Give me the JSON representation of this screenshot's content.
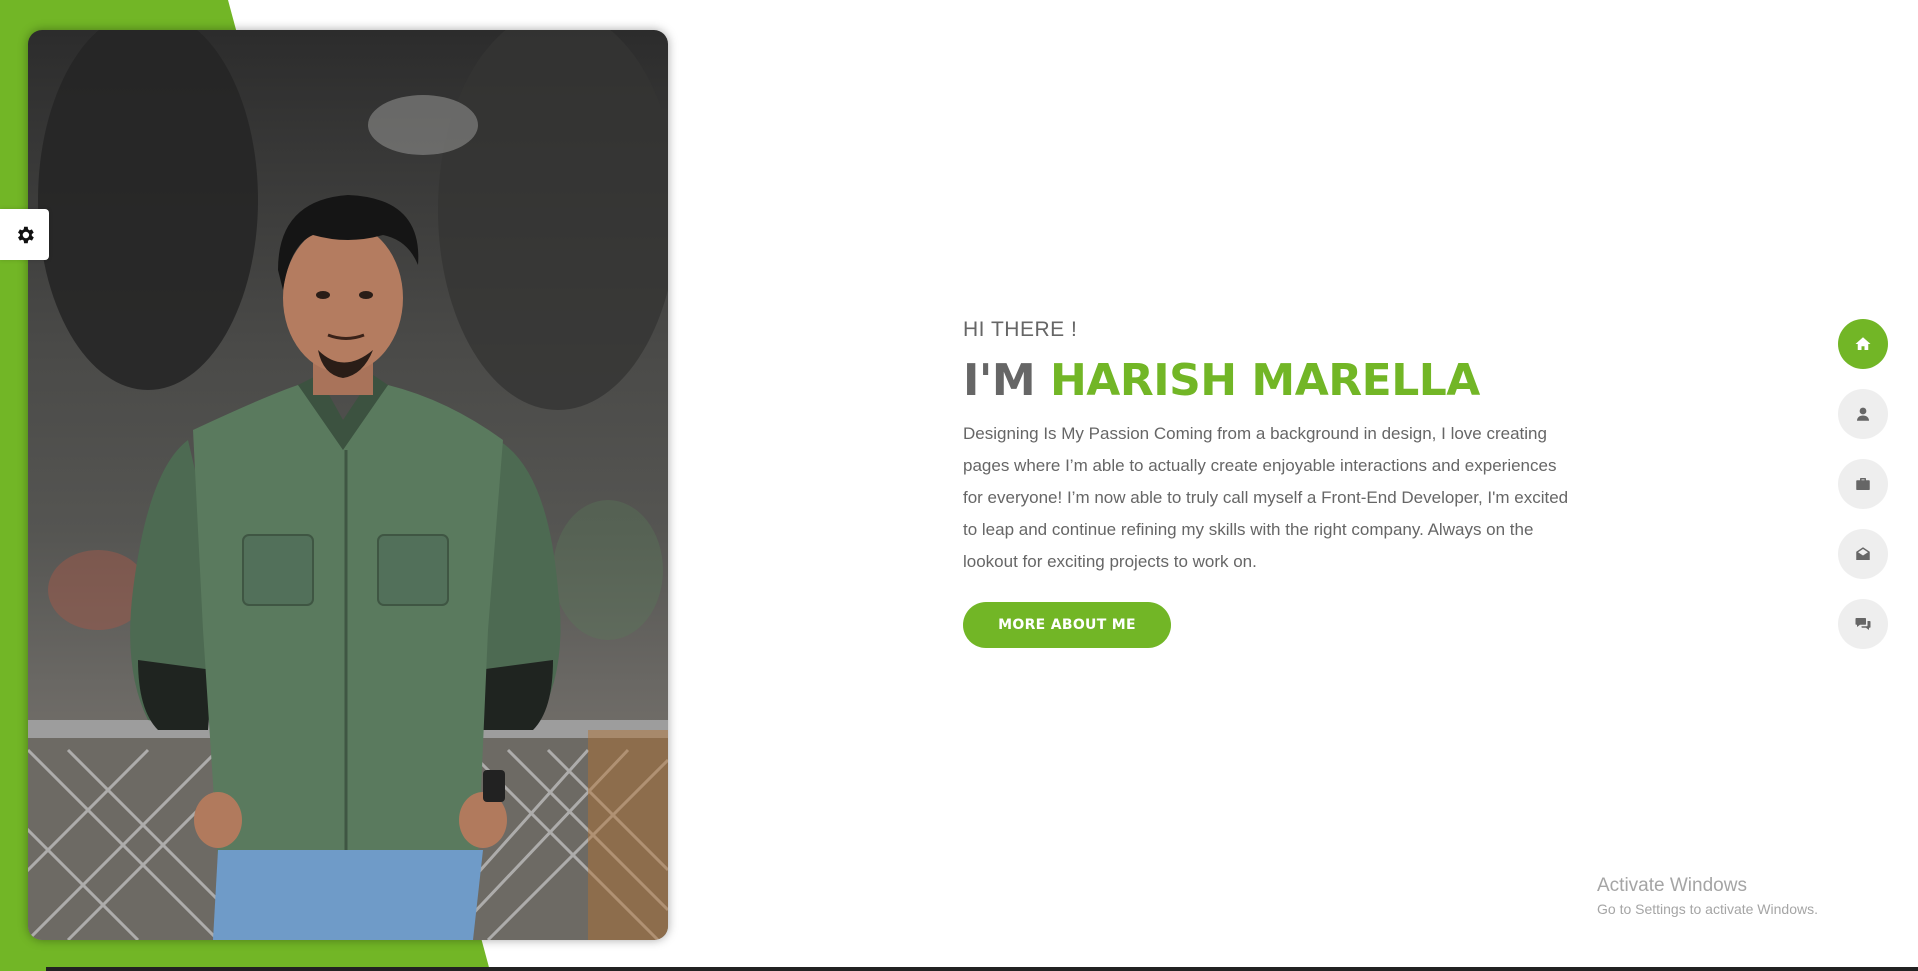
{
  "hero": {
    "greeting": "HI THERE !",
    "headline_prefix": "I'M",
    "name": "HARISH MARELLA",
    "description": "Designing Is My Passion Coming from a background in design, I love creating pages where I’m able to actually create enjoyable interactions and experiences for everyone! I’m now able to truly call myself a Front-End Developer, I'm excited to leap and continue refining my skills with the right company. Always on the lookout for exciting projects to work on.",
    "cta_label": "MORE ABOUT ME"
  },
  "settings": {
    "icon": "gear-icon"
  },
  "nav": {
    "items": [
      {
        "icon": "home-icon",
        "active": true
      },
      {
        "icon": "user-icon",
        "active": false
      },
      {
        "icon": "briefcase-icon",
        "active": false
      },
      {
        "icon": "envelope-open-icon",
        "active": false
      },
      {
        "icon": "comments-icon",
        "active": false
      }
    ]
  },
  "watermark": {
    "title": "Activate Windows",
    "subtitle": "Go to Settings to activate Windows."
  },
  "colors": {
    "accent": "#72b626",
    "text": "#666666",
    "nav_bg": "#eeeeee",
    "background": "#ffffff"
  }
}
